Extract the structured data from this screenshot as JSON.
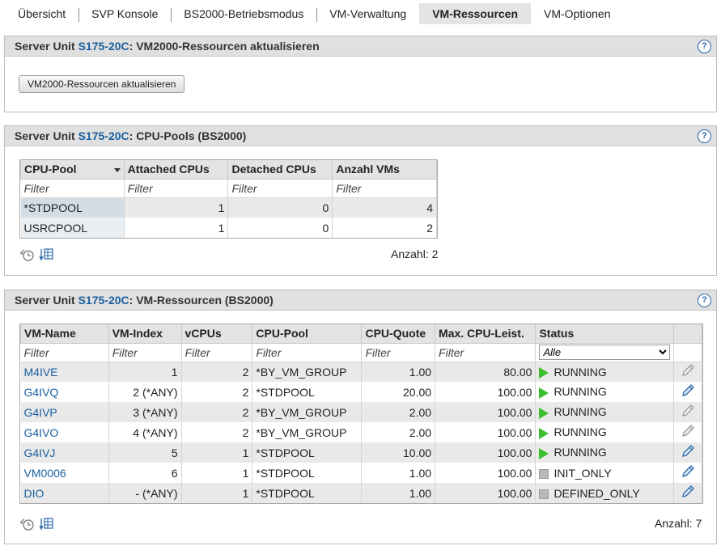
{
  "tabs": [
    {
      "label": "Übersicht"
    },
    {
      "label": "SVP Konsole"
    },
    {
      "label": "BS2000-Betriebsmodus"
    },
    {
      "label": "VM-Verwaltung"
    },
    {
      "label": "VM-Ressourcen",
      "active": true
    },
    {
      "label": "VM-Optionen"
    }
  ],
  "panel1": {
    "prefix": "Server Unit ",
    "unit": "S175-20C",
    "suffix": ": VM2000-Ressourcen aktualisieren",
    "button": "VM2000-Ressourcen aktualisieren",
    "help": "?"
  },
  "panel2": {
    "prefix": "Server Unit ",
    "unit": "S175-20C",
    "suffix": ": CPU-Pools (BS2000)",
    "help": "?",
    "headers": [
      "CPU-Pool",
      "Attached CPUs",
      "Detached CPUs",
      "Anzahl VMs"
    ],
    "filter": "Filter",
    "rows": [
      {
        "pool": "*STDPOOL",
        "attached": "1",
        "detached": "0",
        "vms": "4"
      },
      {
        "pool": "USRCPOOL",
        "attached": "1",
        "detached": "0",
        "vms": "2"
      }
    ],
    "count": "Anzahl: 2"
  },
  "panel3": {
    "prefix": "Server Unit ",
    "unit": "S175-20C",
    "suffix": ": VM-Ressourcen (BS2000)",
    "help": "?",
    "headers": [
      "VM-Name",
      "VM-Index",
      "vCPUs",
      "CPU-Pool",
      "CPU-Quote",
      "Max. CPU-Leist.",
      "Status"
    ],
    "filter": "Filter",
    "status_filter": "Alle",
    "rows": [
      {
        "name": "M4IVE",
        "index": "1",
        "vcpus": "2",
        "pool": "*BY_VM_GROUP",
        "quote": "1.00",
        "max": "80.00",
        "status": "RUNNING",
        "state": "running",
        "edit": false
      },
      {
        "name": "G4IVQ",
        "index": "2 (*ANY)",
        "vcpus": "2",
        "pool": "*STDPOOL",
        "quote": "20.00",
        "max": "100.00",
        "status": "RUNNING",
        "state": "running",
        "edit": true
      },
      {
        "name": "G4IVP",
        "index": "3 (*ANY)",
        "vcpus": "2",
        "pool": "*BY_VM_GROUP",
        "quote": "2.00",
        "max": "100.00",
        "status": "RUNNING",
        "state": "running",
        "edit": false
      },
      {
        "name": "G4IVO",
        "index": "4 (*ANY)",
        "vcpus": "2",
        "pool": "*BY_VM_GROUP",
        "quote": "2.00",
        "max": "100.00",
        "status": "RUNNING",
        "state": "running",
        "edit": false
      },
      {
        "name": "G4IVJ",
        "index": "5",
        "vcpus": "1",
        "pool": "*STDPOOL",
        "quote": "10.00",
        "max": "100.00",
        "status": "RUNNING",
        "state": "running",
        "edit": true
      },
      {
        "name": "VM0006",
        "index": "6",
        "vcpus": "1",
        "pool": "*STDPOOL",
        "quote": "1.00",
        "max": "100.00",
        "status": "INIT_ONLY",
        "state": "stopped",
        "edit": true
      },
      {
        "name": "DIO",
        "index": "- (*ANY)",
        "vcpus": "1",
        "pool": "*STDPOOL",
        "quote": "1.00",
        "max": "100.00",
        "status": "DEFINED_ONLY",
        "state": "stopped",
        "edit": true
      }
    ],
    "count": "Anzahl: 7"
  },
  "colors": {
    "link": "#1a5f9e",
    "running": "#3cbf2f",
    "edit_enabled": "#2a67a8",
    "edit_disabled": "#9a9a9a"
  }
}
